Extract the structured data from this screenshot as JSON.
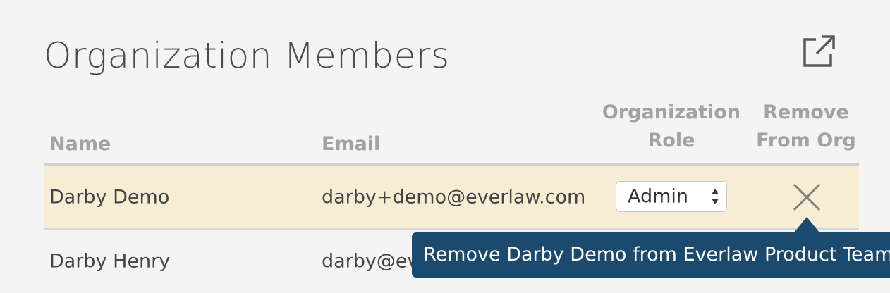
{
  "page": {
    "title": "Organization Members",
    "export_icon": "external-link-icon"
  },
  "table": {
    "columns": {
      "name": "Name",
      "email": "Email",
      "role_line1": "Organization",
      "role_line2": "Role",
      "remove_line1": "Remove",
      "remove_line2": "From Org"
    },
    "rows": [
      {
        "name": "Darby Demo",
        "email": "darby+demo@everlaw.com",
        "role": "Admin",
        "remove_icon": "close-icon",
        "highlighted": true
      },
      {
        "name": "Darby Henry",
        "email": "darby@everlaw.com"
      }
    ]
  },
  "tooltip": {
    "text": "Remove Darby Demo from Everlaw Product Team"
  },
  "colors": {
    "highlight_row": "#f6edd4",
    "tooltip_bg": "#1c4a6e",
    "header_text": "#a2a2a2"
  }
}
